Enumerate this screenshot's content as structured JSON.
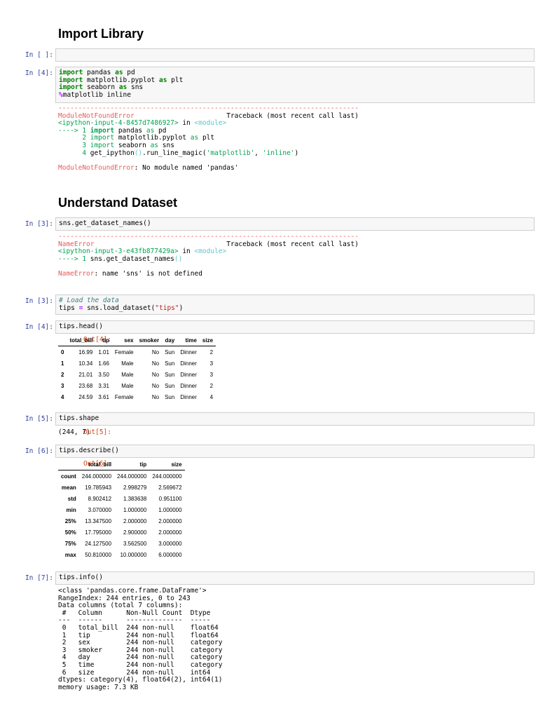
{
  "sections": {
    "import_title": "Import Library",
    "dataset_title": "Understand Dataset"
  },
  "cells": {
    "c1": {
      "prompt": "In [ ]:"
    },
    "c2": {
      "prompt": "In [4]:",
      "code": {
        "l1_kw": "import",
        "l1_mid": " pandas ",
        "l1_kw2": "as",
        "l1_end": " pd",
        "l2_kw": "import",
        "l2_mid": " matplotlib.pyplot ",
        "l2_kw2": "as",
        "l2_end": " plt",
        "l3_kw": "import",
        "l3_mid": " seaborn ",
        "l3_kw2": "as",
        "l3_end": " sns",
        "l4_op": "%",
        "l4_end": "matplotlib inline"
      },
      "error": {
        "dashes": "---------------------------------------------------------------------------",
        "name": "ModuleNotFoundError",
        "traceback_pad": "                       Traceback (most recent call last)",
        "input_ref": "<ipython-input-4-8457d7486927>",
        "in_word": " in ",
        "module": "<module>",
        "t1_arrow": "---->",
        "t1_num": " 1",
        "t1_kw": " import",
        "t1_mid": " pandas ",
        "t1_kw2": "as",
        "t1_end": " pd",
        "t2_num": "      2",
        "t2_kw": " import",
        "t2_mid": " matplotlib.pyplot ",
        "t2_kw2": "as",
        "t2_end": " plt",
        "t3_num": "      3",
        "t3_kw": " import",
        "t3_mid": " seaborn ",
        "t3_kw2": "as",
        "t3_end": " sns",
        "t4_num": "      4",
        "t4_a": " get_ipython",
        "t4_b": "()",
        "t4_c": ".run_line_magic(",
        "t4_d": "'matplotlib'",
        "t4_e": ", ",
        "t4_f": "'inline'",
        "t4_g": ")",
        "final_name": "ModuleNotFoundError",
        "final_msg": ": No module named 'pandas'"
      }
    },
    "c3": {
      "prompt": "In [3]:",
      "code": "sns.get_dataset_names()",
      "error": {
        "dashes": "---------------------------------------------------------------------------",
        "name": "NameError",
        "traceback_pad": "                                 Traceback (most recent call last)",
        "input_ref": "<ipython-input-3-e43fb877429a>",
        "in_word": " in ",
        "module": "<module>",
        "t1_arrow": "---->",
        "t1_num": " 1",
        "t1_a": " sns.get_dataset_names",
        "t1_b": "()",
        "final_name": "NameError",
        "final_msg": ": name 'sns' is not defined"
      }
    },
    "c4": {
      "prompt": "In [3]:",
      "comment": "# Load the data",
      "l2_a": "tips ",
      "l2_op": "=",
      "l2_b": " sns.load_dataset(",
      "l2_str": "\"tips\"",
      "l2_c": ")"
    },
    "c5": {
      "prompt": "In [4]:",
      "code": "tips.head()",
      "out_prompt": "Out[4]:",
      "table": {
        "columns": [
          "",
          "total_bill",
          "tip",
          "sex",
          "smoker",
          "day",
          "time",
          "size"
        ],
        "rows": [
          [
            "0",
            "16.99",
            "1.01",
            "Female",
            "No",
            "Sun",
            "Dinner",
            "2"
          ],
          [
            "1",
            "10.34",
            "1.66",
            "Male",
            "No",
            "Sun",
            "Dinner",
            "3"
          ],
          [
            "2",
            "21.01",
            "3.50",
            "Male",
            "No",
            "Sun",
            "Dinner",
            "3"
          ],
          [
            "3",
            "23.68",
            "3.31",
            "Male",
            "No",
            "Sun",
            "Dinner",
            "2"
          ],
          [
            "4",
            "24.59",
            "3.61",
            "Female",
            "No",
            "Sun",
            "Dinner",
            "4"
          ]
        ]
      }
    },
    "c6": {
      "prompt": "In [5]:",
      "code": "tips.shape",
      "out_prompt": "Out[5]:",
      "output": "(244, 7)"
    },
    "c7": {
      "prompt": "In [6]:",
      "code": "tips.describe()",
      "out_prompt": "Out[6]:",
      "table": {
        "columns": [
          "",
          "total_bill",
          "tip",
          "size"
        ],
        "rows": [
          [
            "count",
            "244.000000",
            "244.000000",
            "244.000000"
          ],
          [
            "mean",
            "19.785943",
            "2.998279",
            "2.569672"
          ],
          [
            "std",
            "8.902412",
            "1.383638",
            "0.951100"
          ],
          [
            "min",
            "3.070000",
            "1.000000",
            "1.000000"
          ],
          [
            "25%",
            "13.347500",
            "2.000000",
            "2.000000"
          ],
          [
            "50%",
            "17.795000",
            "2.900000",
            "2.000000"
          ],
          [
            "75%",
            "24.127500",
            "3.562500",
            "3.000000"
          ],
          [
            "max",
            "50.810000",
            "10.000000",
            "6.000000"
          ]
        ]
      }
    },
    "c8": {
      "prompt": "In [7]:",
      "code": "tips.info()",
      "output_lines": [
        "<class 'pandas.core.frame.DataFrame'>",
        "RangeIndex: 244 entries, 0 to 243",
        "Data columns (total 7 columns):",
        " #   Column      Non-Null Count  Dtype   ",
        "---  ------      --------------  -----   ",
        " 0   total_bill  244 non-null    float64 ",
        " 1   tip         244 non-null    float64 ",
        " 2   sex         244 non-null    category",
        " 3   smoker      244 non-null    category",
        " 4   day         244 non-null    category",
        " 5   time        244 non-null    category",
        " 6   size        244 non-null    int64   ",
        "dtypes: category(4), float64(2), int64(1)",
        "memory usage: 7.3 KB"
      ]
    }
  },
  "colors": {
    "prompt_in": "#303f9f",
    "prompt_out": "#d84315",
    "error_red": "#e75c58",
    "error_green": "#00a250",
    "keyword": "#008000",
    "string": "#ba2121"
  }
}
